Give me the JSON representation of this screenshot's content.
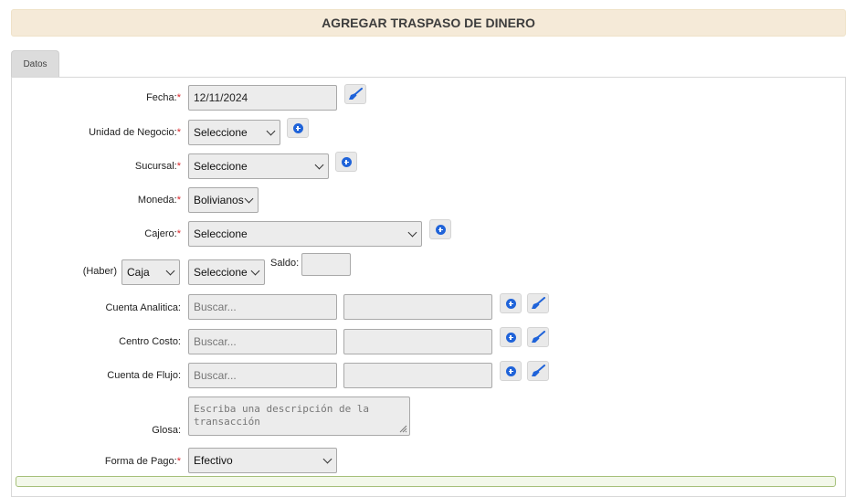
{
  "header": {
    "title": "AGREGAR TRASPASO DE DINERO"
  },
  "tabs": [
    {
      "label": "Datos"
    }
  ],
  "required_mark": "*",
  "form": {
    "fecha": {
      "label": "Fecha:",
      "value": "12/11/2024"
    },
    "unidad_negocio": {
      "label": "Unidad de Negocio:",
      "value": "Seleccione"
    },
    "sucursal": {
      "label": "Sucursal:",
      "value": "Seleccione"
    },
    "moneda": {
      "label": "Moneda:",
      "value": "Bolivianos"
    },
    "cajero": {
      "label": "Cajero:",
      "value": "Seleccione"
    },
    "haber": {
      "label": "(Haber)",
      "tipo_value": "Caja",
      "cuenta_value": "Seleccione",
      "saldo_label": "Saldo:",
      "saldo_value": ""
    },
    "cuenta_analitica": {
      "label": "Cuenta Analitica:",
      "placeholder": "Buscar..."
    },
    "centro_costo": {
      "label": "Centro Costo:",
      "placeholder": "Buscar..."
    },
    "cuenta_flujo": {
      "label": "Cuenta de Flujo:",
      "placeholder": "Buscar..."
    },
    "glosa": {
      "label": "Glosa:",
      "placeholder": "Escriba una descripción de la transacción"
    },
    "forma_pago": {
      "label": "Forma de Pago:",
      "value": "Efectivo"
    }
  },
  "icons": {
    "add": "plus-circle-icon",
    "clear": "broom-icon"
  },
  "colors": {
    "header_bg": "#f5ead8",
    "accent_blue": "#1f63d9",
    "required_red": "#d9262b",
    "success_border": "#a6c07a"
  }
}
